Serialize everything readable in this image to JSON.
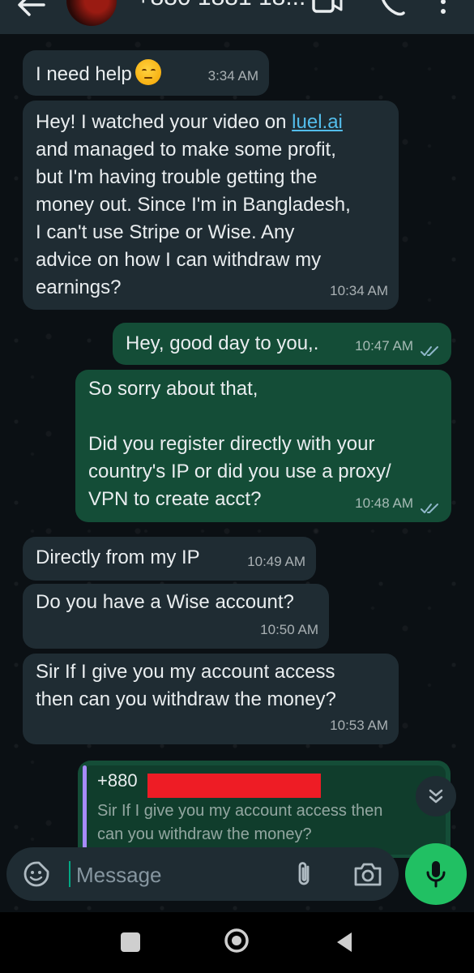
{
  "header": {
    "contact_name": "+880 1881 18...",
    "icons": [
      "back-arrow-icon",
      "avatar",
      "video-call-icon",
      "voice-call-icon",
      "more-options-icon"
    ]
  },
  "messages": [
    {
      "direction": "incoming",
      "text": "I need help",
      "emoji": "pensive-face",
      "time": "3:34 AM"
    },
    {
      "direction": "incoming",
      "text_before_link": "Hey! I watched your video on ",
      "link": "luel.ai",
      "text_after_link": "\nand managed to make some profit,\nbut I'm having trouble getting the\nmoney out. Since I'm in Bangladesh,\nI can't use Stripe or Wise. Any\nadvice on how I can withdraw my\nearnings?",
      "time": "10:34 AM"
    },
    {
      "direction": "outgoing",
      "text": "Hey, good day to you,.",
      "time": "10:47 AM",
      "status": "read"
    },
    {
      "direction": "outgoing",
      "text": "So sorry about that,\n\nDid you register directly with your\ncountry's IP or did you use a proxy/\nVPN to create acct?",
      "time": "10:48 AM",
      "status": "read"
    },
    {
      "direction": "incoming",
      "text": "Directly from my IP",
      "time": "10:49 AM"
    },
    {
      "direction": "incoming",
      "text": "Do you have a Wise account?",
      "time": "10:50 AM"
    },
    {
      "direction": "incoming",
      "text": "Sir If I give you my account access\nthen can you withdraw the money?",
      "time": "10:53 AM"
    }
  ],
  "reply_preview": {
    "sender": "+880",
    "text": "Sir If I give you my account access then\ncan you withdraw the money?"
  },
  "input": {
    "placeholder": "Message"
  },
  "colors": {
    "background": "#0b1014",
    "incoming_bubble": "#1f2c33",
    "outgoing_bubble": "#144d37",
    "link": "#53bdeb",
    "read_ticks": "#8fb7c9",
    "mic_button": "#21c063",
    "redaction": "#ee1c25"
  }
}
